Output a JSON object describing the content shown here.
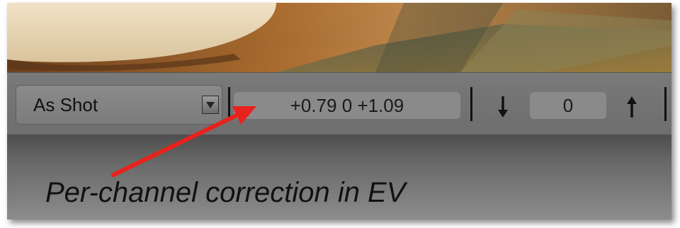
{
  "toolbar": {
    "preset_dropdown": {
      "selected": "As Shot",
      "arrow_icon": "chevron-down-icon"
    },
    "channel_correction": "+0.79 0 +1.09",
    "lower_arrow_icon": "arrow-down-icon",
    "value_field": "0",
    "raise_arrow_icon": "arrow-up-icon"
  },
  "annotation": {
    "caption": "Per-channel correction in EV",
    "pointer_color": "#e8221c"
  }
}
